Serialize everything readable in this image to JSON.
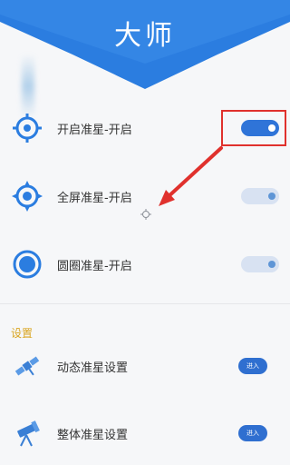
{
  "header": {
    "title": "大师"
  },
  "accent_color": "#2f74d8",
  "toggles": [
    {
      "label": "开启准星-开启",
      "icon": "crosshair-target-icon",
      "state": "on"
    },
    {
      "label": "全屏准星-开启",
      "icon": "diamond-target-icon",
      "state": "off"
    },
    {
      "label": "圆圈准星-开启",
      "icon": "circle-target-icon",
      "state": "off"
    }
  ],
  "settings": {
    "section_label": "设置",
    "items": [
      {
        "label": "动态准星设置",
        "icon": "satellite-icon",
        "button_label": "进入"
      },
      {
        "label": "整体准星设置",
        "icon": "telescope-icon",
        "button_label": "进入"
      }
    ]
  }
}
